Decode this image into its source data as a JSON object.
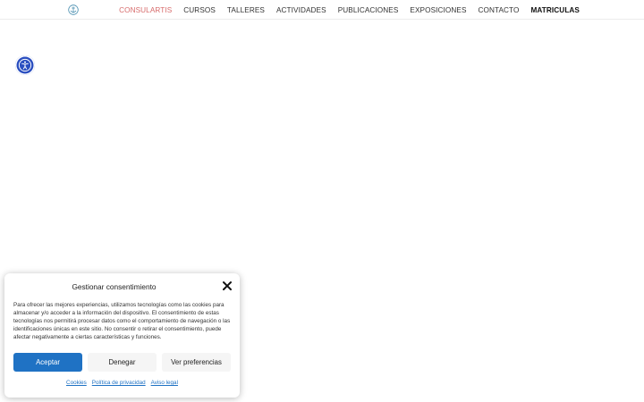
{
  "header": {
    "nav": [
      {
        "label": "CONSULARTIS",
        "state": "active"
      },
      {
        "label": "CURSOS",
        "state": "normal"
      },
      {
        "label": "TALLERES",
        "state": "normal"
      },
      {
        "label": "ACTIVIDADES",
        "state": "normal"
      },
      {
        "label": "PUBLICACIONES",
        "state": "normal"
      },
      {
        "label": "EXPOSICIONES",
        "state": "normal"
      },
      {
        "label": "CONTACTO",
        "state": "normal"
      },
      {
        "label": "MATRICULAS",
        "state": "bold"
      }
    ]
  },
  "consent": {
    "title": "Gestionar consentimiento",
    "body": "Para ofrecer las mejores experiencias, utilizamos tecnologías como las cookies para almacenar y/o acceder a la información del dispositivo. El consentimiento de estas tecnologías nos permitirá procesar datos como el comportamiento de navegación o las identificaciones únicas en este sitio. No consentir o retirar el consentimiento, puede afectar negativamente a ciertas características y funciones.",
    "accept_label": "Aceptar",
    "deny_label": "Denegar",
    "prefs_label": "Ver preferencias",
    "links": {
      "cookies": "Cookies",
      "privacy": "Política de privacidad",
      "legal": "Aviso legal"
    }
  },
  "colors": {
    "accent": "#d76b6b",
    "primary_button": "#1f72c4",
    "accessibility_button": "#2b4fc0"
  },
  "icons": {
    "logo": "anchor-logo-icon",
    "accessibility": "accessibility-icon",
    "close": "close-icon"
  }
}
